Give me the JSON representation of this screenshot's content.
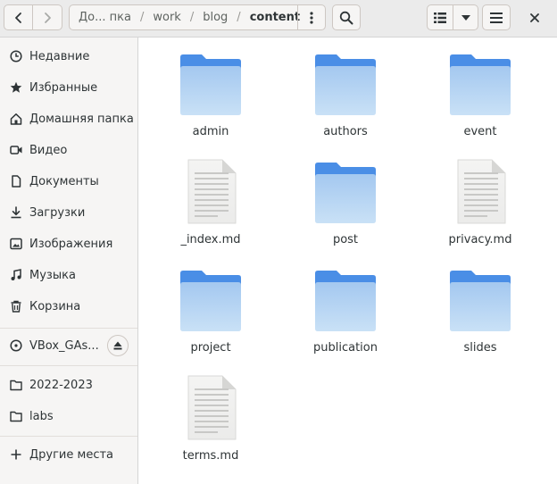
{
  "headerbar": {
    "back_icon": "go-previous-icon",
    "forward_icon": "go-next-icon",
    "path": [
      "До... пка",
      "work",
      "blog",
      "content"
    ],
    "path_menu_icon": "view-more-icon",
    "search_icon": "search-icon",
    "view_list_icon": "view-list-icon",
    "view_dropdown_icon": "chevron-down-icon",
    "menu_icon": "open-menu-icon",
    "close_icon": "close-icon"
  },
  "sidebar": {
    "places": [
      {
        "label": "Недавние",
        "icon": "recent-icon"
      },
      {
        "label": "Избранные",
        "icon": "star-icon"
      },
      {
        "label": "Домашняя папка",
        "icon": "home-icon"
      },
      {
        "label": "Видео",
        "icon": "video-icon"
      },
      {
        "label": "Документы",
        "icon": "document-icon"
      },
      {
        "label": "Загрузки",
        "icon": "download-icon"
      },
      {
        "label": "Изображения",
        "icon": "image-icon"
      },
      {
        "label": "Музыка",
        "icon": "music-icon"
      },
      {
        "label": "Корзина",
        "icon": "trash-icon"
      }
    ],
    "devices": [
      {
        "label": "VBox_GAs...",
        "icon": "disc-icon",
        "eject_icon": "eject-icon"
      }
    ],
    "bookmarks": [
      {
        "label": "2022-2023",
        "icon": "folder-icon"
      },
      {
        "label": "labs",
        "icon": "folder-icon"
      }
    ],
    "other": {
      "label": "Другие места",
      "icon": "plus-icon"
    }
  },
  "files": [
    {
      "name": "admin",
      "type": "folder"
    },
    {
      "name": "authors",
      "type": "folder"
    },
    {
      "name": "event",
      "type": "folder"
    },
    {
      "name": "_index.md",
      "type": "text"
    },
    {
      "name": "post",
      "type": "folder"
    },
    {
      "name": "privacy.md",
      "type": "text"
    },
    {
      "name": "project",
      "type": "folder"
    },
    {
      "name": "publication",
      "type": "folder"
    },
    {
      "name": "slides",
      "type": "folder"
    },
    {
      "name": "terms.md",
      "type": "text"
    }
  ],
  "colors": {
    "folder_top": "#4a8ee6",
    "folder_front_top": "#a4c8f0",
    "folder_front_bottom": "#c9e1f6",
    "headerbar_bg": "#ebebeb",
    "sidebar_bg": "#f6f5f4"
  }
}
